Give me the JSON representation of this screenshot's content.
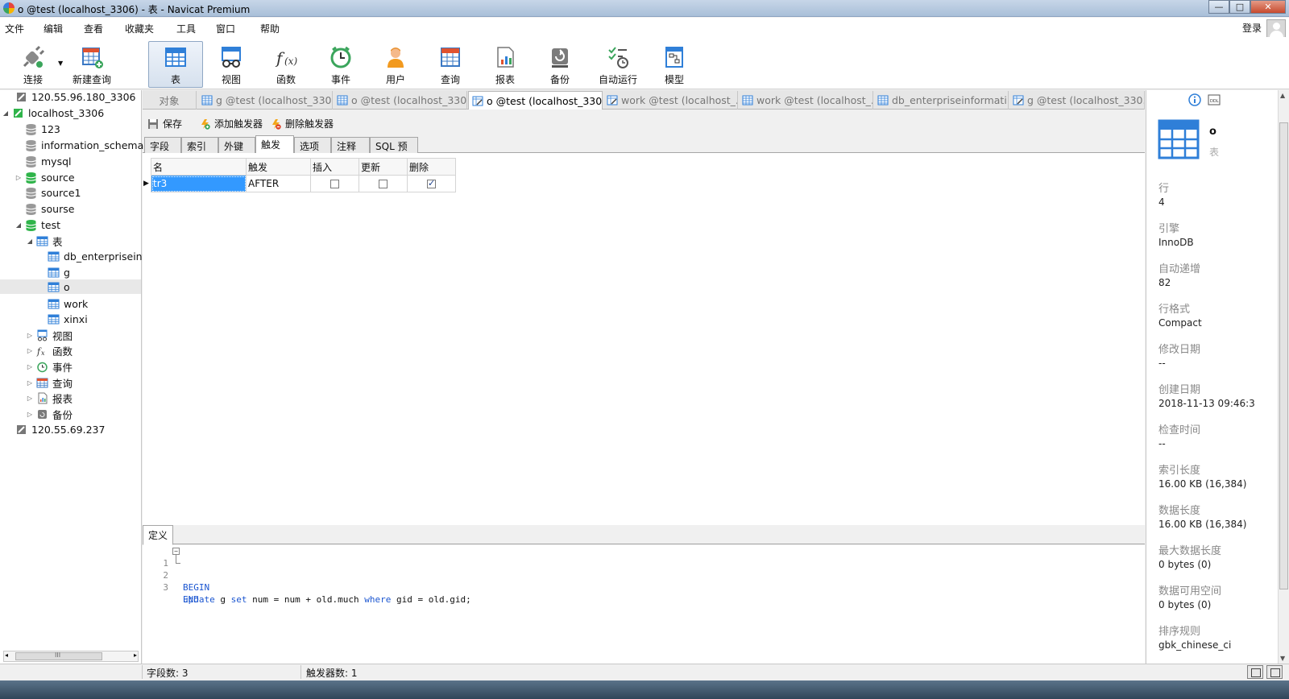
{
  "window": {
    "title": "o @test (localhost_3306) - 表 - Navicat Premium",
    "controls": [
      "—",
      "□",
      "✕"
    ]
  },
  "menu": {
    "items": [
      "文件",
      "编辑",
      "查看",
      "收藏夹",
      "工具",
      "窗口",
      "帮助"
    ],
    "login": "登录"
  },
  "toolbar": {
    "buttons": [
      {
        "label": "连接",
        "icon": "plug-icon"
      },
      {
        "label": "新建查询",
        "icon": "new-query-icon"
      },
      {
        "label": "表",
        "icon": "table-icon",
        "active": true
      },
      {
        "label": "视图",
        "icon": "view-icon"
      },
      {
        "label": "函数",
        "icon": "function-icon"
      },
      {
        "label": "事件",
        "icon": "clock-icon"
      },
      {
        "label": "用户",
        "icon": "user-icon"
      },
      {
        "label": "查询",
        "icon": "query-icon"
      },
      {
        "label": "报表",
        "icon": "report-icon"
      },
      {
        "label": "备份",
        "icon": "backup-icon"
      },
      {
        "label": "自动运行",
        "icon": "schedule-icon"
      },
      {
        "label": "模型",
        "icon": "model-icon"
      }
    ]
  },
  "tree": {
    "nodes": [
      {
        "label": "120.55.96.180_3306",
        "type": "server-off"
      },
      {
        "label": "localhost_3306",
        "type": "server-on"
      },
      {
        "label": "123",
        "type": "db-off"
      },
      {
        "label": "information_schema",
        "type": "db-off"
      },
      {
        "label": "mysql",
        "type": "db-off"
      },
      {
        "label": "source",
        "type": "db-on"
      },
      {
        "label": "source1",
        "type": "db-off"
      },
      {
        "label": "sourse",
        "type": "db-off"
      },
      {
        "label": "test",
        "type": "db-on"
      },
      {
        "label": "表",
        "type": "tables-folder"
      },
      {
        "label": "db_enterpriseinf",
        "type": "table"
      },
      {
        "label": "g",
        "type": "table"
      },
      {
        "label": "o",
        "type": "table",
        "selected": true
      },
      {
        "label": "work",
        "type": "table"
      },
      {
        "label": "xinxi",
        "type": "table"
      },
      {
        "label": "视图",
        "type": "views-folder"
      },
      {
        "label": "函数",
        "type": "functions-folder"
      },
      {
        "label": "事件",
        "type": "events-folder"
      },
      {
        "label": "查询",
        "type": "queries-folder"
      },
      {
        "label": "报表",
        "type": "reports-folder"
      },
      {
        "label": "备份",
        "type": "backups-folder"
      },
      {
        "label": "120.55.69.237",
        "type": "server-off"
      }
    ],
    "scroll_grip": "III"
  },
  "object_tabs": {
    "first": "对象",
    "tabs": [
      {
        "label": "g @test (localhost_330...",
        "icon": "table-icon"
      },
      {
        "label": "o @test (localhost_330...",
        "icon": "table-icon"
      },
      {
        "label": "o @test (localhost_330...",
        "icon": "design-table-icon",
        "active": true
      },
      {
        "label": "work @test (localhost_...",
        "icon": "design-table-icon"
      },
      {
        "label": "work @test (localhost_...",
        "icon": "table-icon"
      },
      {
        "label": "db_enterpriseinformati...",
        "icon": "table-icon"
      },
      {
        "label": "g @test (localhost_330...",
        "icon": "design-table-icon"
      }
    ]
  },
  "editor_toolbar": {
    "save": "保存",
    "add_trigger": "添加触发器",
    "delete_trigger": "删除触发器"
  },
  "sub_tabs": {
    "items": [
      "字段",
      "索引",
      "外键",
      "触发器",
      "选项",
      "注释",
      "SQL 预览"
    ],
    "active_index": 3
  },
  "trigger_grid": {
    "columns": [
      "名",
      "触发",
      "插入",
      "更新",
      "删除"
    ],
    "rows": [
      {
        "name": "tr3",
        "timing": "AFTER",
        "insert": false,
        "update": false,
        "delete": true
      }
    ]
  },
  "definition": {
    "tab": "定义",
    "lines": [
      {
        "num": "1",
        "text": "BEGIN"
      },
      {
        "num": "2",
        "text": "update g set num = num + old.much where gid = old.gid;"
      },
      {
        "num": "3",
        "text": "END"
      }
    ]
  },
  "info_panel": {
    "name": "o",
    "type": "表",
    "properties": [
      {
        "key": "行",
        "value": "4"
      },
      {
        "key": "引擎",
        "value": "InnoDB"
      },
      {
        "key": "自动递增",
        "value": "82"
      },
      {
        "key": "行格式",
        "value": "Compact"
      },
      {
        "key": "修改日期",
        "value": "--"
      },
      {
        "key": "创建日期",
        "value": "2018-11-13 09:46:3"
      },
      {
        "key": "检查时间",
        "value": "--"
      },
      {
        "key": "索引长度",
        "value": "16.00 KB (16,384)"
      },
      {
        "key": "数据长度",
        "value": "16.00 KB (16,384)"
      },
      {
        "key": "最大数据长度",
        "value": "0 bytes (0)"
      },
      {
        "key": "数据可用空间",
        "value": "0 bytes (0)"
      },
      {
        "key": "排序规则",
        "value": "gbk_chinese_ci"
      }
    ],
    "ddl_label": "DDL"
  },
  "status": {
    "fields": "字段数: 3",
    "triggers": "触发器数: 1"
  },
  "colors": {
    "accent": "#3399ff",
    "server_on": "#2fb44a",
    "db_on": "#2fb44a",
    "table_icon": "#2f7fd8",
    "keyword": "#1a55d0"
  }
}
